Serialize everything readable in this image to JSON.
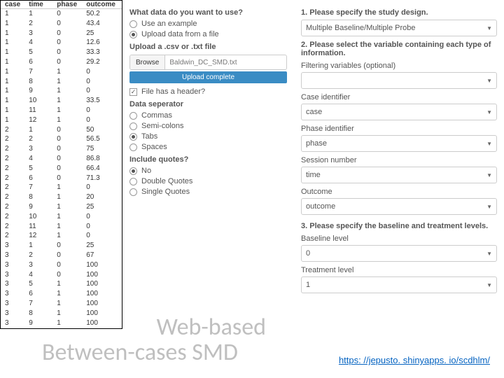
{
  "table": {
    "headers": [
      "case",
      "time",
      "phase",
      "outcome"
    ],
    "rows": [
      [
        "1",
        "1",
        "0",
        "50.2"
      ],
      [
        "1",
        "2",
        "0",
        "43.4"
      ],
      [
        "1",
        "3",
        "0",
        "25"
      ],
      [
        "1",
        "4",
        "0",
        "12.6"
      ],
      [
        "1",
        "5",
        "0",
        "33.3"
      ],
      [
        "1",
        "6",
        "0",
        "29.2"
      ],
      [
        "1",
        "7",
        "1",
        "0"
      ],
      [
        "1",
        "8",
        "1",
        "0"
      ],
      [
        "1",
        "9",
        "1",
        "0"
      ],
      [
        "1",
        "10",
        "1",
        "33.5"
      ],
      [
        "1",
        "11",
        "1",
        "0"
      ],
      [
        "1",
        "12",
        "1",
        "0"
      ],
      [
        "2",
        "1",
        "0",
        "50"
      ],
      [
        "2",
        "2",
        "0",
        "56.5"
      ],
      [
        "2",
        "3",
        "0",
        "75"
      ],
      [
        "2",
        "4",
        "0",
        "86.8"
      ],
      [
        "2",
        "5",
        "0",
        "66.4"
      ],
      [
        "2",
        "6",
        "0",
        "71.3"
      ],
      [
        "2",
        "7",
        "1",
        "0"
      ],
      [
        "2",
        "8",
        "1",
        "20"
      ],
      [
        "2",
        "9",
        "1",
        "25"
      ],
      [
        "2",
        "10",
        "1",
        "0"
      ],
      [
        "2",
        "11",
        "1",
        "0"
      ],
      [
        "2",
        "12",
        "1",
        "0"
      ],
      [
        "3",
        "1",
        "0",
        "25"
      ],
      [
        "3",
        "2",
        "0",
        "67"
      ],
      [
        "3",
        "3",
        "0",
        "100"
      ],
      [
        "3",
        "4",
        "0",
        "100"
      ],
      [
        "3",
        "5",
        "1",
        "100"
      ],
      [
        "3",
        "6",
        "1",
        "100"
      ],
      [
        "3",
        "7",
        "1",
        "100"
      ],
      [
        "3",
        "8",
        "1",
        "100"
      ],
      [
        "3",
        "9",
        "1",
        "100"
      ]
    ]
  },
  "middle": {
    "q_data": "What data do you want to use?",
    "opt_example": "Use an example",
    "opt_upload": "Upload data from a file",
    "upload_label": "Upload a .csv or .txt file",
    "browse": "Browse",
    "file_name": "Baldwin_DC_SMD.txt",
    "upload_status": "Upload complete",
    "header_check": "File has a header?",
    "sep_label": "Data seperator",
    "sep_commas": "Commas",
    "sep_semi": "Semi-colons",
    "sep_tabs": "Tabs",
    "sep_spaces": "Spaces",
    "quotes_label": "Include quotes?",
    "q_no": "No",
    "q_double": "Double Quotes",
    "q_single": "Single Quotes"
  },
  "right": {
    "q1": "1. Please specify the study design.",
    "design_value": "Multiple Baseline/Multiple Probe",
    "q2": "2. Please select the variable containing each type of information.",
    "filter_label": "Filtering variables (optional)",
    "filter_value": "",
    "case_label": "Case identifier",
    "case_value": "case",
    "phase_label": "Phase identifier",
    "phase_value": "phase",
    "session_label": "Session number",
    "session_value": "time",
    "outcome_label": "Outcome",
    "outcome_value": "outcome",
    "q3": "3. Please specify the baseline and treatment levels.",
    "baseline_label": "Baseline level",
    "baseline_value": "0",
    "treatment_label": "Treatment level",
    "treatment_value": "1"
  },
  "big_title_l1": "Web-based",
  "big_title_l2": "Between-cases SMD",
  "url": "https: //jepusto. shinyapps. io/scdhlm/"
}
